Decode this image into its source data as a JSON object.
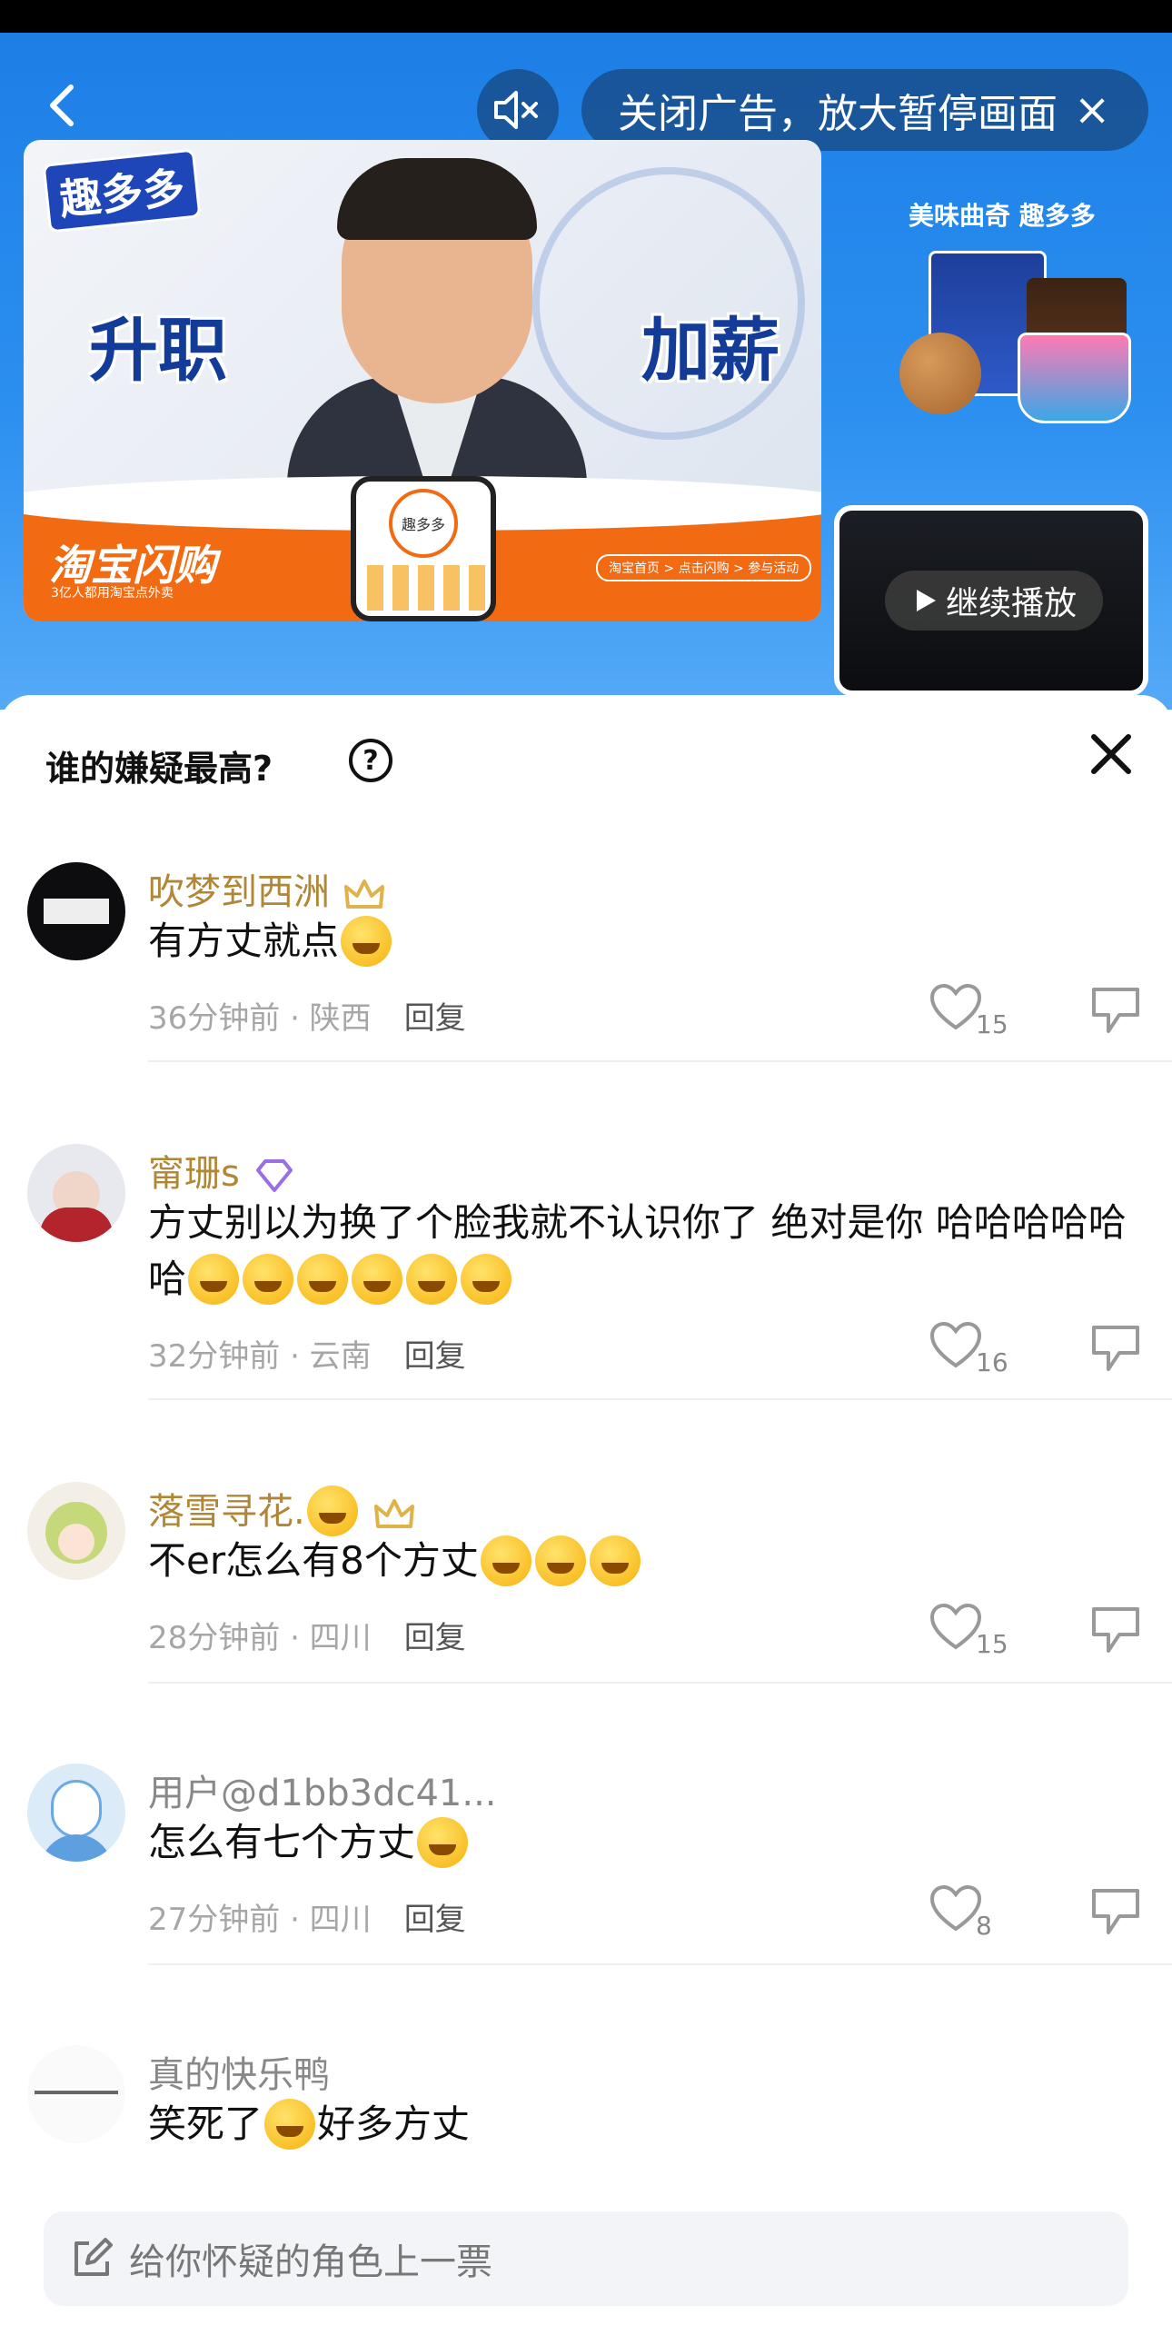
{
  "ad": {
    "close_label": "关闭广告，放大暂停画面",
    "close_x": "×",
    "left_word": "升职",
    "right_word": "加薪",
    "brand_badge": "趣多多",
    "taobao_title": "淘宝闪购",
    "taobao_sub": "3亿人都用淘宝点外卖",
    "phone_ring": "趣多多",
    "steps": "淘宝首页 > 点击闪购 > 参与活动",
    "side_title": "美味曲奇 趣多多",
    "continue_label": "继续播放",
    "colors": {
      "blue": "#2b8ff0",
      "orange": "#f26a12",
      "brand_blue": "#123c98"
    }
  },
  "sheet": {
    "title": "谁的嫌疑最高?",
    "help_icon": "?",
    "close_icon": "close-icon"
  },
  "comments": [
    {
      "user": "吹梦到西洲",
      "text": "有方丈就点",
      "time_location": "36分钟前 · 陕西",
      "reply": "回复",
      "likes": "15"
    },
    {
      "user": "甯珊s",
      "text": "方丈别以为换了个脸我就不认识你了 绝对是你 哈哈哈哈哈哈",
      "time_location": "32分钟前 · 云南",
      "reply": "回复",
      "likes": "16"
    },
    {
      "user": "落雪寻花.",
      "text": "不er怎么有8个方丈",
      "time_location": "28分钟前 · 四川",
      "reply": "回复",
      "likes": "15"
    },
    {
      "user": "用户@d1bb3dc41...",
      "text": "怎么有七个方丈",
      "time_location": "27分钟前 · 四川",
      "reply": "回复",
      "likes": "8"
    },
    {
      "user": "真的快乐鸭",
      "text_before": "笑死了",
      "text_after": "好多方丈"
    }
  ],
  "input": {
    "placeholder": "给你怀疑的角色上一票",
    "icon": "edit-icon"
  }
}
